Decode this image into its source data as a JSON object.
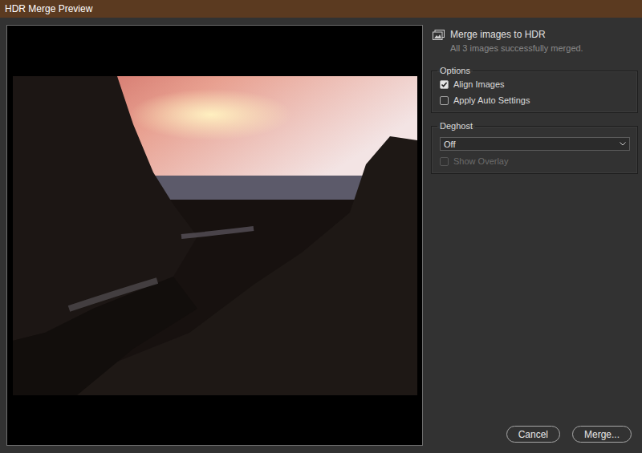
{
  "window": {
    "title": "HDR Merge Preview"
  },
  "header": {
    "title": "Merge images to HDR",
    "status": "All 3 images successfully merged."
  },
  "options": {
    "legend": "Options",
    "checkboxes": [
      {
        "label": "Align Images",
        "checked": true,
        "disabled": false
      },
      {
        "label": "Apply Auto Settings",
        "checked": false,
        "disabled": false
      }
    ]
  },
  "deghost": {
    "legend": "Deghost",
    "select": {
      "value": "Off"
    },
    "checkboxes": [
      {
        "label": "Show Overlay",
        "checked": false,
        "disabled": true
      }
    ]
  },
  "buttons": [
    {
      "label": "Cancel"
    },
    {
      "label": "Merge..."
    }
  ]
}
